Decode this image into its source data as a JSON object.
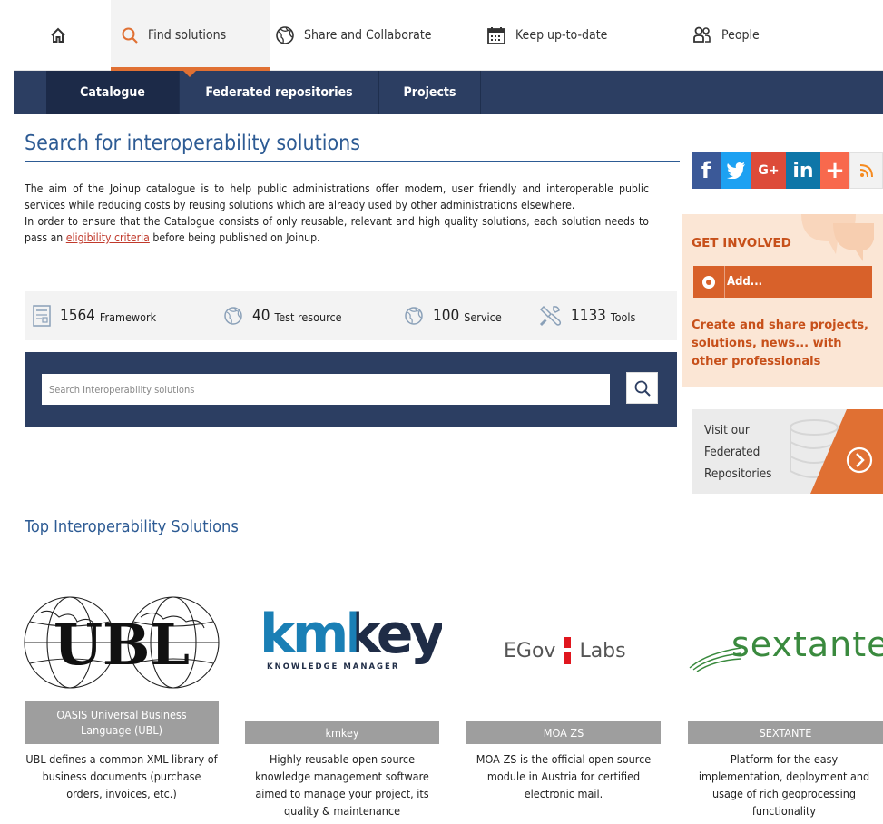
{
  "topnav": {
    "home_icon": "home-icon",
    "items": [
      {
        "label": "Find solutions",
        "icon": "magnifier-icon",
        "active": true
      },
      {
        "label": "Share and Collaborate",
        "icon": "globe-icon"
      },
      {
        "label": "Keep up-to-date",
        "icon": "calendar-icon"
      },
      {
        "label": "People",
        "icon": "people-icon"
      }
    ]
  },
  "subnav": {
    "items": [
      {
        "label": "Catalogue",
        "active": true
      },
      {
        "label": "Federated repositories"
      },
      {
        "label": "Projects"
      }
    ]
  },
  "main": {
    "title": "Search for interoperability solutions",
    "intro_1": "The aim of the Joinup catalogue is to help public administrations offer modern, user friendly and interoperable public services while reducing costs by reusing solutions which are already used by other administrations elsewhere.",
    "intro_2_before": "In order to ensure that the Catalogue consists of only reusable, relevant and high quality solutions, each solution needs to pass an ",
    "intro_2_link": "eligibility criteria",
    "intro_2_after": " before being published on Joinup.",
    "stats": [
      {
        "value": "1564",
        "label": "Framework",
        "icon": "document-icon"
      },
      {
        "value": "40",
        "label": "Test resource",
        "icon": "globe-icon"
      },
      {
        "value": "100",
        "label": "Service",
        "icon": "globe-icon"
      },
      {
        "value": "1133",
        "label": "Tools",
        "icon": "tools-icon"
      }
    ],
    "search_placeholder": "Search Interoperability solutions",
    "top_title": "Top Interoperability Solutions"
  },
  "solutions": [
    {
      "name": "OASIS Universal Business Language (UBL)",
      "desc": "UBL defines a common XML library of business documents (purchase orders, invoices, etc.)",
      "logo_text": "UBL"
    },
    {
      "name": "kmkey",
      "desc": "Highly reusable open source knowledge management software aimed to manage your project, its quality & maintenance",
      "logo_text": "kmkey",
      "logo_sub": "KNOWLEDGE MANAGER"
    },
    {
      "name": "MOA ZS",
      "desc": "MOA-ZS is the official open source module in Austria for certified electronic mail.",
      "logo_text_1": "EGov",
      "logo_text_2": "Labs"
    },
    {
      "name": "SEXTANTE",
      "desc": "Platform for the easy implementation, deployment and usage of rich geoprocessing functionality",
      "logo_text": "sextante"
    }
  ],
  "sidebar": {
    "social": [
      {
        "label": "f",
        "icon": "facebook-icon",
        "color": "#3b5998"
      },
      {
        "label": "twitter",
        "icon": "twitter-icon",
        "color": "#1da1f2"
      },
      {
        "label": "G+",
        "icon": "googleplus-icon",
        "color": "#dd4b39"
      },
      {
        "label": "in",
        "icon": "linkedin-icon",
        "color": "#0e76a8"
      },
      {
        "label": "+",
        "icon": "addthis-icon",
        "color": "#f8694d"
      },
      {
        "label": "rss",
        "icon": "rss-icon",
        "color": "#f2f2f2"
      }
    ],
    "get_involved": {
      "title": "GET INVOLVED",
      "add_label": "Add...",
      "text": "Create and share projects, solutions, news... with other professionals"
    },
    "visit": {
      "text_1": "Visit our",
      "text_2": "Federated",
      "text_3": "Repositories"
    }
  },
  "colors": {
    "accent": "#e07033",
    "navy": "#2c3e62",
    "title_blue": "#2d5b94",
    "orange_text": "#c7501a"
  }
}
